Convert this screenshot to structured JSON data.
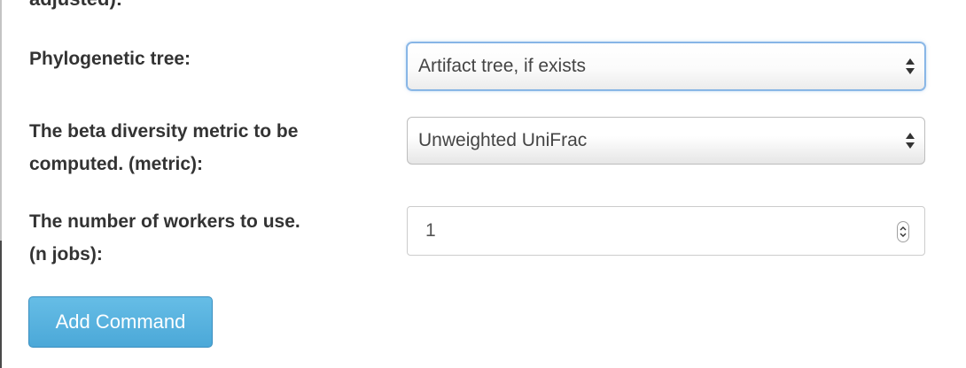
{
  "form": {
    "cut_off_label": "adjusted):",
    "phylogenetic_tree": {
      "label": "Phylogenetic tree:",
      "selected": "Artifact tree, if exists"
    },
    "beta_metric": {
      "label_line1": "The beta diversity metric to be",
      "label_line2": "computed. (metric):",
      "selected": "Unweighted UniFrac"
    },
    "n_jobs": {
      "label_line1": "The number of workers to use.",
      "label_line2": "(n jobs):",
      "value": "1"
    }
  },
  "actions": {
    "add_command_label": "Add Command"
  },
  "icons": {
    "select_arrows": "updown-arrows-icon",
    "number_spinner": "spinner-arrows-icon"
  },
  "colors": {
    "primary_button": "#5bb3e0",
    "focus_ring": "#7fb0e4",
    "label_text": "#333333"
  }
}
